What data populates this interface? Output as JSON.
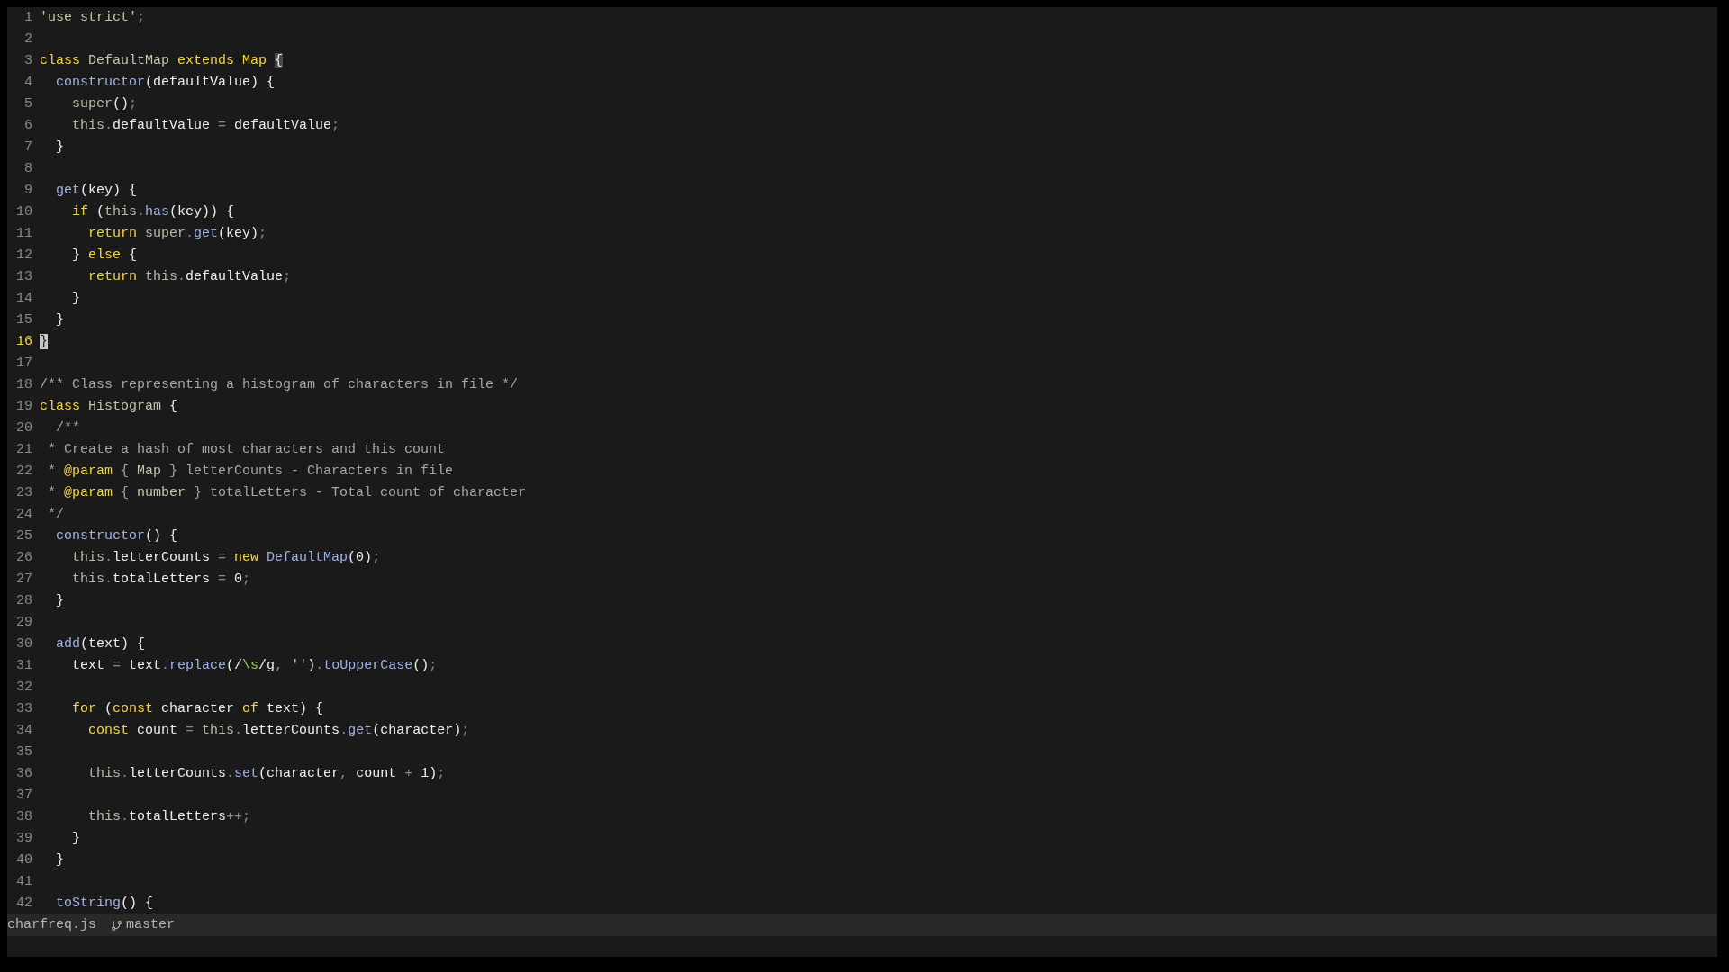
{
  "lines": [
    {
      "number": "1",
      "current": false,
      "tokens": [
        {
          "kind": "string",
          "text": "'use strict'"
        },
        {
          "kind": "punct",
          "text": ";"
        }
      ]
    },
    {
      "number": "2",
      "current": false
    },
    {
      "number": "3",
      "current": false,
      "tokens": [
        {
          "kind": "keyword",
          "text": "class "
        },
        {
          "kind": "type",
          "text": "DefaultMap "
        },
        {
          "kind": "keyword",
          "text": "extends Map "
        },
        {
          "kind": "match",
          "text": "{"
        }
      ]
    },
    {
      "number": "4",
      "current": false,
      "tokens": [
        {
          "kind": "function",
          "text": "  constructor"
        },
        {
          "kind": "plain",
          "text": "(defaultValue) {"
        }
      ]
    },
    {
      "number": "5",
      "current": false,
      "tokens": [
        {
          "kind": "this",
          "text": "    super"
        },
        {
          "kind": "plain",
          "text": "()"
        },
        {
          "kind": "punct",
          "text": ";"
        }
      ]
    },
    {
      "number": "6",
      "current": false,
      "tokens": [
        {
          "kind": "this",
          "text": "    this"
        },
        {
          "kind": "punct",
          "text": "."
        },
        {
          "kind": "plain",
          "text": "defaultValue "
        },
        {
          "kind": "punct",
          "text": "= "
        },
        {
          "kind": "plain",
          "text": "defaultValue"
        },
        {
          "kind": "punct",
          "text": ";"
        }
      ]
    },
    {
      "number": "7",
      "current": false,
      "tokens": [
        {
          "kind": "plain",
          "text": "  }"
        }
      ]
    },
    {
      "number": "8",
      "current": false
    },
    {
      "number": "9",
      "current": false,
      "tokens": [
        {
          "kind": "function",
          "text": "  get"
        },
        {
          "kind": "plain",
          "text": "(key) {"
        }
      ]
    },
    {
      "number": "10",
      "current": false,
      "tokens": [
        {
          "kind": "keyword",
          "text": "    if "
        },
        {
          "kind": "plain",
          "text": "("
        },
        {
          "kind": "this",
          "text": "this"
        },
        {
          "kind": "punct",
          "text": "."
        },
        {
          "kind": "function",
          "text": "has"
        },
        {
          "kind": "plain",
          "text": "(key)) {"
        }
      ]
    },
    {
      "number": "11",
      "current": false,
      "tokens": [
        {
          "kind": "keyword",
          "text": "      return "
        },
        {
          "kind": "this",
          "text": "super"
        },
        {
          "kind": "punct",
          "text": "."
        },
        {
          "kind": "function",
          "text": "get"
        },
        {
          "kind": "plain",
          "text": "(key)"
        },
        {
          "kind": "punct",
          "text": ";"
        }
      ]
    },
    {
      "number": "12",
      "current": false,
      "tokens": [
        {
          "kind": "plain",
          "text": "    } "
        },
        {
          "kind": "keyword",
          "text": "else "
        },
        {
          "kind": "plain",
          "text": "{"
        }
      ]
    },
    {
      "number": "13",
      "current": false,
      "tokens": [
        {
          "kind": "keyword",
          "text": "      return "
        },
        {
          "kind": "this",
          "text": "this"
        },
        {
          "kind": "punct",
          "text": "."
        },
        {
          "kind": "plain",
          "text": "defaultValue"
        },
        {
          "kind": "punct",
          "text": ";"
        }
      ]
    },
    {
      "number": "14",
      "current": false,
      "tokens": [
        {
          "kind": "plain",
          "text": "    }"
        }
      ]
    },
    {
      "number": "15",
      "current": false,
      "tokens": [
        {
          "kind": "plain",
          "text": "  }"
        }
      ]
    },
    {
      "number": "16",
      "current": true,
      "tokens": [
        {
          "kind": "cursor",
          "text": "}"
        }
      ]
    },
    {
      "number": "17",
      "current": false
    },
    {
      "number": "18",
      "current": false,
      "tokens": [
        {
          "kind": "comment",
          "text": "/** Class representing a histogram of characters in file */"
        }
      ]
    },
    {
      "number": "19",
      "current": false,
      "tokens": [
        {
          "kind": "keyword",
          "text": "class "
        },
        {
          "kind": "type",
          "text": "Histogram "
        },
        {
          "kind": "plain",
          "text": "{"
        }
      ]
    },
    {
      "number": "20",
      "current": false,
      "tokens": [
        {
          "kind": "comment",
          "text": "  /**"
        }
      ]
    },
    {
      "number": "21",
      "current": false,
      "tokens": [
        {
          "kind": "comment",
          "text": " * Create a hash of most characters and this count"
        }
      ]
    },
    {
      "number": "22",
      "current": false,
      "tokens": [
        {
          "kind": "comment",
          "text": " * "
        },
        {
          "kind": "tag",
          "text": "@param"
        },
        {
          "kind": "comment",
          "text": " { "
        },
        {
          "kind": "type",
          "text": "Map"
        },
        {
          "kind": "comment",
          "text": " } letterCounts - Characters in file"
        }
      ]
    },
    {
      "number": "23",
      "current": false,
      "tokens": [
        {
          "kind": "comment",
          "text": " * "
        },
        {
          "kind": "tag",
          "text": "@param"
        },
        {
          "kind": "comment",
          "text": " { "
        },
        {
          "kind": "type",
          "text": "number"
        },
        {
          "kind": "comment",
          "text": " } totalLetters - Total count of character"
        }
      ]
    },
    {
      "number": "24",
      "current": false,
      "tokens": [
        {
          "kind": "comment",
          "text": " */"
        }
      ]
    },
    {
      "number": "25",
      "current": false,
      "tokens": [
        {
          "kind": "function",
          "text": "  constructor"
        },
        {
          "kind": "plain",
          "text": "() {"
        }
      ]
    },
    {
      "number": "26",
      "current": false,
      "tokens": [
        {
          "kind": "this",
          "text": "    this"
        },
        {
          "kind": "punct",
          "text": "."
        },
        {
          "kind": "plain",
          "text": "letterCounts "
        },
        {
          "kind": "punct",
          "text": "= "
        },
        {
          "kind": "keyword",
          "text": "new "
        },
        {
          "kind": "function",
          "text": "DefaultMap"
        },
        {
          "kind": "plain",
          "text": "(0)"
        },
        {
          "kind": "punct",
          "text": ";"
        }
      ]
    },
    {
      "number": "27",
      "current": false,
      "tokens": [
        {
          "kind": "this",
          "text": "    this"
        },
        {
          "kind": "punct",
          "text": "."
        },
        {
          "kind": "plain",
          "text": "totalLetters "
        },
        {
          "kind": "punct",
          "text": "= "
        },
        {
          "kind": "plain",
          "text": "0"
        },
        {
          "kind": "punct",
          "text": ";"
        }
      ]
    },
    {
      "number": "28",
      "current": false,
      "tokens": [
        {
          "kind": "plain",
          "text": "  }"
        }
      ]
    },
    {
      "number": "29",
      "current": false
    },
    {
      "number": "30",
      "current": false,
      "tokens": [
        {
          "kind": "function",
          "text": "  add"
        },
        {
          "kind": "plain",
          "text": "(text) {"
        }
      ]
    },
    {
      "number": "31",
      "current": false,
      "tokens": [
        {
          "kind": "plain",
          "text": "    text "
        },
        {
          "kind": "punct",
          "text": "= "
        },
        {
          "kind": "plain",
          "text": "text"
        },
        {
          "kind": "punct",
          "text": "."
        },
        {
          "kind": "function",
          "text": "replace"
        },
        {
          "kind": "plain",
          "text": "(/"
        },
        {
          "kind": "regex",
          "text": "\\s"
        },
        {
          "kind": "plain",
          "text": "/g"
        },
        {
          "kind": "punct",
          "text": ", "
        },
        {
          "kind": "string",
          "text": "''"
        },
        {
          "kind": "plain",
          "text": ")"
        },
        {
          "kind": "punct",
          "text": "."
        },
        {
          "kind": "function",
          "text": "toUpperCase"
        },
        {
          "kind": "plain",
          "text": "()"
        },
        {
          "kind": "punct",
          "text": ";"
        }
      ]
    },
    {
      "number": "32",
      "current": false
    },
    {
      "number": "33",
      "current": false,
      "tokens": [
        {
          "kind": "keyword",
          "text": "    for "
        },
        {
          "kind": "plain",
          "text": "("
        },
        {
          "kind": "keyword",
          "text": "const "
        },
        {
          "kind": "plain",
          "text": "character "
        },
        {
          "kind": "keyword",
          "text": "of "
        },
        {
          "kind": "plain",
          "text": "text) {"
        }
      ]
    },
    {
      "number": "34",
      "current": false,
      "tokens": [
        {
          "kind": "keyword",
          "text": "      const "
        },
        {
          "kind": "plain",
          "text": "count "
        },
        {
          "kind": "punct",
          "text": "= "
        },
        {
          "kind": "this",
          "text": "this"
        },
        {
          "kind": "punct",
          "text": "."
        },
        {
          "kind": "plain",
          "text": "letterCounts"
        },
        {
          "kind": "punct",
          "text": "."
        },
        {
          "kind": "function",
          "text": "get"
        },
        {
          "kind": "plain",
          "text": "(character)"
        },
        {
          "kind": "punct",
          "text": ";"
        }
      ]
    },
    {
      "number": "35",
      "current": false
    },
    {
      "number": "36",
      "current": false,
      "tokens": [
        {
          "kind": "this",
          "text": "      this"
        },
        {
          "kind": "punct",
          "text": "."
        },
        {
          "kind": "plain",
          "text": "letterCounts"
        },
        {
          "kind": "punct",
          "text": "."
        },
        {
          "kind": "function",
          "text": "set"
        },
        {
          "kind": "plain",
          "text": "(character"
        },
        {
          "kind": "punct",
          "text": ", "
        },
        {
          "kind": "plain",
          "text": "count "
        },
        {
          "kind": "punct",
          "text": "+ "
        },
        {
          "kind": "plain",
          "text": "1)"
        },
        {
          "kind": "punct",
          "text": ";"
        }
      ]
    },
    {
      "number": "37",
      "current": false
    },
    {
      "number": "38",
      "current": false,
      "tokens": [
        {
          "kind": "this",
          "text": "      this"
        },
        {
          "kind": "punct",
          "text": "."
        },
        {
          "kind": "plain",
          "text": "totalLetters"
        },
        {
          "kind": "punct",
          "text": "++;"
        }
      ]
    },
    {
      "number": "39",
      "current": false,
      "tokens": [
        {
          "kind": "plain",
          "text": "    }"
        }
      ]
    },
    {
      "number": "40",
      "current": false,
      "tokens": [
        {
          "kind": "plain",
          "text": "  }"
        }
      ]
    },
    {
      "number": "41",
      "current": false
    },
    {
      "number": "42",
      "current": false,
      "tokens": [
        {
          "kind": "function",
          "text": "  toString"
        },
        {
          "kind": "plain",
          "text": "() {"
        }
      ]
    }
  ],
  "status_bar": {
    "file": "charfreq.js",
    "branch": "master"
  }
}
